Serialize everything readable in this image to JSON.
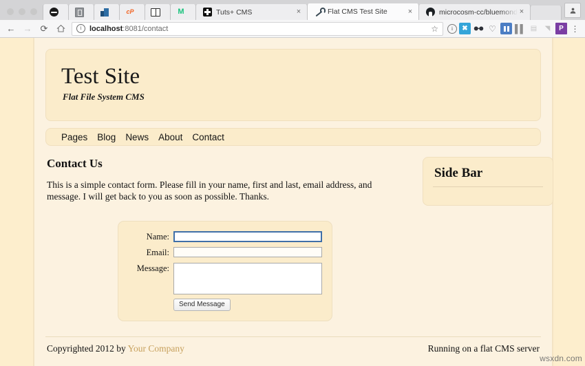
{
  "browser": {
    "window_controls": [
      "close",
      "minimize",
      "maximize"
    ],
    "pinned_tabs": [
      {
        "icon": "dark-circle-icon",
        "title": ""
      },
      {
        "icon": "grey-book-icon",
        "title": ""
      },
      {
        "icon": "blue-blocks-icon",
        "title": ""
      },
      {
        "icon": "cpanel-icon",
        "title": "cP"
      },
      {
        "icon": "open-book-icon",
        "title": ""
      },
      {
        "icon": "green-m-icon",
        "title": ""
      }
    ],
    "tabs": [
      {
        "title": "Tuts+ CMS",
        "icon": "tuts-plus-icon",
        "active": false,
        "close_label": "×"
      },
      {
        "title": "Flat CMS Test Site",
        "icon": "wrench-icon",
        "active": true,
        "close_label": "×"
      },
      {
        "title": "microcosm-cc/bluemonday: b",
        "icon": "github-icon",
        "active": false,
        "close_label": "×"
      }
    ],
    "new_tab_label": "",
    "profile_icon": "person-icon",
    "nav": {
      "back_icon": "←",
      "forward_icon": "→",
      "reload_icon": "⟳",
      "home_icon": "⌂"
    },
    "omnibox": {
      "info_icon": "ⓘ",
      "url_host": "localhost",
      "url_path": ":8081/contact",
      "full_url": "localhost:8081/contact",
      "bookmark_icon": "☆"
    },
    "extensions": [
      {
        "name": "info-extension-icon",
        "glyph": "i",
        "style": "info-c"
      },
      {
        "name": "blue-square-extension-icon",
        "glyph": "✖",
        "style": "sq-blue"
      },
      {
        "name": "glasses-extension-icon",
        "glyph": "◖◗",
        "style": "glasses"
      },
      {
        "name": "heart-extension-icon",
        "glyph": "♡",
        "style": "heart"
      },
      {
        "name": "trello-extension-icon",
        "glyph": "",
        "style": "trello"
      },
      {
        "name": "bars-extension-icon",
        "glyph": "▐▐",
        "style": "bars"
      },
      {
        "name": "faded-extension-icon-1",
        "glyph": "▤",
        "style": "faded"
      },
      {
        "name": "faded-extension-icon-2",
        "glyph": "◥",
        "style": "faded"
      },
      {
        "name": "pocket-extension-icon",
        "glyph": "P",
        "style": "purple-p"
      },
      {
        "name": "chrome-menu-icon",
        "glyph": "⋮",
        "style": "kebab"
      }
    ]
  },
  "site": {
    "title": "Test Site",
    "tagline": "Flat File System CMS",
    "nav": [
      {
        "label": "Pages"
      },
      {
        "label": "Blog"
      },
      {
        "label": "News"
      },
      {
        "label": "About"
      },
      {
        "label": "Contact"
      }
    ],
    "main": {
      "heading": "Contact Us",
      "paragraph": "This is a simple contact form. Please fill in your name, first and last, email address, and message. I will get back to you as soon as possible. Thanks."
    },
    "sidebar": {
      "title": "Side Bar"
    },
    "form": {
      "name_label": "Name:",
      "name_value": "",
      "email_label": "Email:",
      "email_value": "",
      "message_label": "Message:",
      "message_value": "",
      "submit_label": "Send Message"
    },
    "footer": {
      "copyright_prefix": "Copyrighted 2012 by ",
      "company_link": "Your Company",
      "right_text": "Running on a flat CMS server"
    }
  },
  "watermark": "wsxdn.com",
  "colors": {
    "page_bg": "#fdeecd",
    "panel_bg": "#fcf2e0",
    "box_bg": "#fbeccb",
    "box_border": "#f0dfbe",
    "link": "#c7a15d",
    "focus_ring": "#3f6fa8"
  }
}
